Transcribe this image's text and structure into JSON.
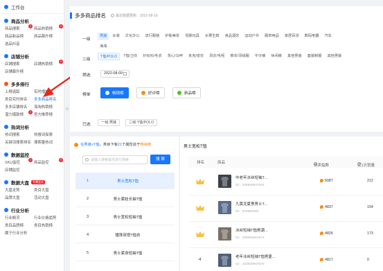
{
  "sidebar": {
    "workbench": "工作台",
    "sections": [
      {
        "title": "商品分析",
        "color": "#1677ff",
        "items": [
          {
            "label": "商品搜索",
            "badge": "9"
          },
          {
            "label": "商品热销榜",
            "badge": "9"
          },
          {
            "label": "商品新品榜"
          },
          {
            "label": "商品飙升榜"
          },
          {
            "label": "选品抖音"
          }
        ]
      },
      {
        "title": "店铺分析",
        "color": "#1677ff",
        "items": [
          {
            "label": "店铺搜索"
          },
          {
            "label": "店铺热销榜",
            "badge": "9"
          },
          {
            "label": "店铺飙升榜"
          }
        ]
      },
      {
        "title": "多多排行",
        "color": "#fa541c",
        "items": [
          {
            "label": "上榜追踪"
          },
          {
            "label": "实时播放榜"
          },
          {
            "label": "类目实时排名"
          },
          {
            "label": "多多商品排名",
            "active": true
          },
          {
            "label": "多多店铺排名"
          },
          {
            "label": "海淘热销榜"
          },
          {
            "label": "潜力爆款榜",
            "badge": "9"
          },
          {
            "label": "官方推荐榜"
          }
        ]
      },
      {
        "title": "热词分析",
        "color": "#1677ff",
        "items": [
          {
            "label": "热词搜索"
          },
          {
            "label": "热搜词探索"
          },
          {
            "label": "关键词搜索排名"
          },
          {
            "label": "搜索量热词"
          }
        ]
      },
      {
        "title": "数据监控",
        "color": "#1677ff",
        "items": [
          {
            "label": "SKU监控",
            "badge": "9"
          },
          {
            "label": "商品监控",
            "badge": "9"
          },
          {
            "label": "店铺监控"
          }
        ]
      },
      {
        "title": "数据大盘",
        "color": "#1677ff",
        "hot": "专属会员",
        "items": [
          {
            "label": "大盘走势"
          },
          {
            "label": "类目大盘"
          },
          {
            "label": "品牌大盘"
          },
          {
            "label": "活动大盘"
          }
        ]
      },
      {
        "title": "行业分析",
        "color": "#1677ff",
        "items": [
          {
            "label": "行业概况"
          },
          {
            "label": "行业价格趋势"
          },
          {
            "label": "类目品牌榜"
          },
          {
            "label": "类目热销榜"
          },
          {
            "label": "属于行业分析"
          }
        ]
      }
    ]
  },
  "filter": {
    "title": "多多商品排名",
    "update_time": "最近数据更新：2022-08-10",
    "level1_label": "一级",
    "level1": [
      "男装",
      "女装",
      "文化办公",
      "流行服装",
      "护肤美妆",
      "母婴玩具",
      "水果生鲜",
      "食品酒饮",
      "运动户外",
      "服饰用品",
      "家居百货",
      "数码电器",
      "汽车",
      "海淘"
    ],
    "level1_selected": 0,
    "level2_label": "二级",
    "level2": [
      "T恤/POLO",
      "T恤/卫衣",
      "针织衫/毛衣",
      "背心/马甲",
      "夹克/皮衣",
      "风衣/毛呢",
      "棉衣/羽绒服",
      "牛仔裤",
      "休闲裤",
      "其他男装",
      "套装制服",
      "其他男装"
    ],
    "level2_selected": 0,
    "date_label": "筛选",
    "date_value": "2022-08-09",
    "list_label": "榜单",
    "list_buttons": [
      "畅销榜",
      "好评榜",
      "新品榜"
    ],
    "list_dots": [
      "#ffffff",
      "#fa8c16",
      "#52c41a"
    ],
    "selected_label": "已选",
    "selected_tags": [
      "一级:男装",
      "二级:T恤/POLO"
    ]
  },
  "left_panel": {
    "notice_prefix": "在男装>T恤",
    "notice_mid": "类目下有",
    "notice_count": "21",
    "notice_tail": "个属性处于",
    "notice_hot": "畅销榜",
    "search_placeholder": "请输入搜索属性进行搜索",
    "search_button": "搜 索",
    "categories": [
      {
        "num": "1",
        "name": "男士宽松T恤"
      },
      {
        "num": "2",
        "name": "男士套娃长袖T恤"
      },
      {
        "num": "3",
        "name": "男士宽松短袖T恤"
      },
      {
        "num": "4",
        "name": "撞珠穿搭T恤衣"
      },
      {
        "num": "5",
        "name": "男士紧身短袖T恤"
      }
    ]
  },
  "right_panel": {
    "title": "男士宽松T恤",
    "headers": {
      "rank": "排名",
      "product": "商品",
      "hot": "热卖指数",
      "sales": "近1天销量"
    },
    "rows": [
      {
        "rank": "1",
        "name": "中老年冰丝短袖T...",
        "id": "ID：226680947644",
        "hot": "5087",
        "sales": "212",
        "img": "#3a3f48"
      },
      {
        "rank": "2",
        "name": "九黄龙夏季男士T...",
        "id": "ID：675660262",
        "hot": "4837",
        "sales": "154",
        "img": "#586b8a"
      },
      {
        "rank": "3",
        "name": "冰丝短袖T恤男潮...",
        "id": "ID：335093561074",
        "hot": "4826",
        "sales": "173",
        "img": "#7a6f66"
      },
      {
        "rank": "4",
        "name": "老年冰丝短袖T恤男夏...",
        "id": "ID：243600997578",
        "hot": "4817",
        "sales": "0",
        "img": "#4e5e78"
      }
    ]
  }
}
